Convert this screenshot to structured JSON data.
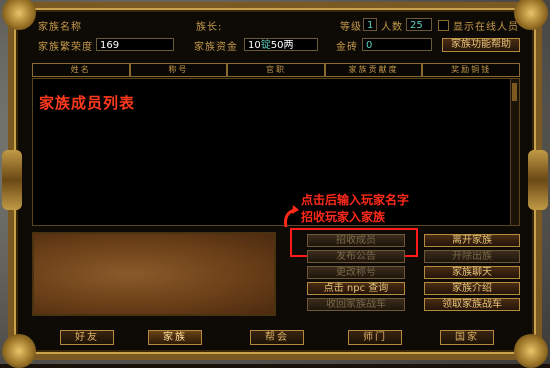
{
  "info": {
    "family_name_label": "家族名称",
    "leader_label": "族长:",
    "level_label": "等级",
    "level_value": "1",
    "members_label": "人数",
    "members_value": "25",
    "show_online_label": "显示在线人员",
    "prestige_label": "家族繁荣度",
    "prestige_value": "169",
    "funds_label": "家族资金",
    "funds_value_prefix": "10",
    "funds_unit_mid": "锭",
    "funds_value_suffix": "50两",
    "gold_label": "金砖",
    "gold_value": "0",
    "help_button": "家族功能帮助"
  },
  "table": {
    "headers": [
      "姓名",
      "称号",
      "官职",
      "家族贡献度",
      "奖励铜钱"
    ]
  },
  "list": {
    "title": "家族成员列表"
  },
  "annotation": {
    "line1": "点击后输入玩家名字",
    "line2": "招收玩家入家族"
  },
  "actions": {
    "recruit": "招收成员",
    "leave": "离开家族",
    "public": "发布公告",
    "expel": "开除出族",
    "change_title": "更改称号",
    "chat": "家族聊天",
    "npc_query": "点击 npc 查询",
    "intro": "家族介绍",
    "recv_war": "收回家族战车",
    "get_war": "领取家族战车"
  },
  "tabs": [
    "好友",
    "家族",
    "帮会",
    "师门",
    "国家"
  ],
  "active_tab": "家族",
  "colors": {
    "gold": "#c79a4b",
    "title_red": "#ff3a1e",
    "annotation_red": "#ff2a1a",
    "value_cyan": "#5fd0c0"
  }
}
